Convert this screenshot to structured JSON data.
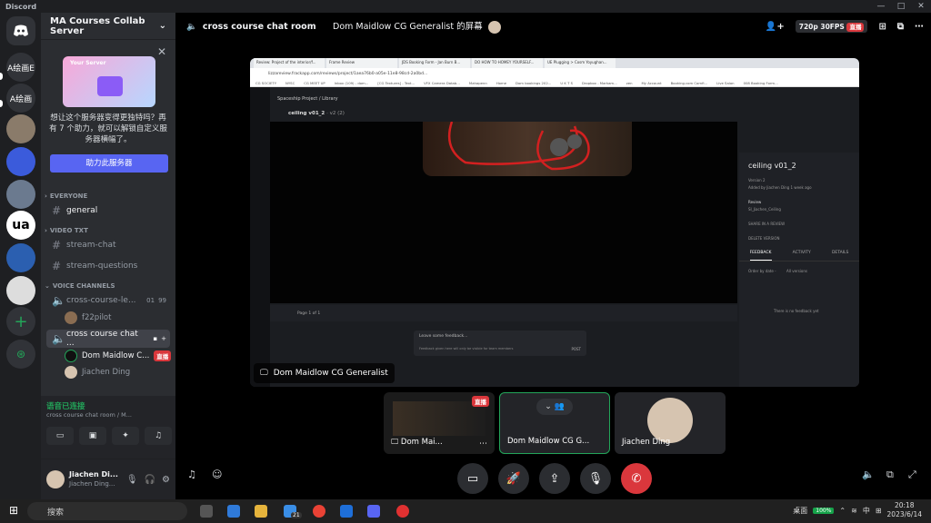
{
  "titlebar": {
    "app_name": "Discord",
    "minimize": "—",
    "maximize": "□",
    "close": "✕"
  },
  "servers": [
    {
      "label": "A绘画E"
    },
    {
      "label": "A绘画"
    },
    {
      "label": ""
    },
    {
      "label": ""
    },
    {
      "label": ""
    },
    {
      "label": "ua"
    },
    {
      "label": ""
    },
    {
      "label": ""
    }
  ],
  "guild": {
    "name": "MA Courses Collab Server"
  },
  "promo": {
    "badge": "Your Server",
    "text": "想让这个服务器变得更独特吗？再有 7 个助力，就可以解锁自定义服务器横幅了。",
    "button": "助力此服务器"
  },
  "categories": {
    "everyone": "EVERYONE",
    "video": "VIDEO TXT",
    "voice": "VOICE CHANNELS"
  },
  "channels": {
    "general": "general",
    "stream_chat": "stream-chat",
    "stream_questions": "stream-questions",
    "voice1": "cross-course-le...",
    "voice1_count": "01",
    "voice1_limit": "99",
    "voice1_user": "f22pilot",
    "voice2": "cross course chat ...",
    "voice2_user1": "Dom Maidlow C...",
    "voice2_live": "直播",
    "voice2_user2": "Jiachen Ding"
  },
  "voice_panel": {
    "status": "语音已连接",
    "sub": "cross course chat room / M..."
  },
  "userbar": {
    "name": "Jiachen Di...",
    "tag": "Jiachen Ding..."
  },
  "stage": {
    "channel": "cross course chat room",
    "stream_title": "Dom Maidlow CG Generalist 的屏幕",
    "quality": "720p 30FPS",
    "live": "直播"
  },
  "browser": {
    "tabs": [
      "Review: Project of the interior/f...",
      "Frame Review",
      "JDS Booking Form - Jan Burn B...",
      "DO HOW TO HOMEY YOURSELF...",
      "UE Plugging > Cosm Yoyughan..."
    ],
    "url": "lizzareview.frackapp.com/reviews/project/1aea76b0-a05e-11e8-98cd-2a0bd...",
    "bookmarks": [
      "CG SOCIETY",
      "NYSC",
      "CG MEET UP",
      "Inbox (109) - dom...",
      "[CG Textures] - Text...",
      "VFX Camera Datab...",
      "Mahapenn",
      "Home",
      "Dom bookings 202...",
      "U K T S",
      "Dropbox - Markam...",
      "zen",
      "My Account",
      "Booking.com Comfi...",
      "Live Salon",
      "008 Booking Form..."
    ]
  },
  "frame": {
    "breadcrumb": "Spaceship Project / Library",
    "version": "ceiling v01_2",
    "version_suffix": "· v2 (2)",
    "page": "Page 1 of 1",
    "feedback_placeholder": "Leave some feedback...",
    "feedback_note": "Feedback given here will only be visible for team members",
    "post": "POST",
    "panel_title": "ceiling v01_2",
    "panel_version": "Version 2",
    "panel_added": "Added by Jiachen Ding 1 week ago",
    "panel_review": "Review",
    "panel_review_name": "SI_Jiachen_Ceiling",
    "panel_share": "SHARE IN A REVIEW",
    "panel_delete": "DELETE VERSION",
    "tab_feedback": "FEEDBACK",
    "tab_activity": "ACTIVITY",
    "tab_details": "DETAILS",
    "order_by": "Order by date -",
    "all_versions": "All versions",
    "empty": "There is no feedback yet"
  },
  "screen_label": "Dom Maidlow CG Generalist",
  "tiles": {
    "t1_label": "Dom Mai...",
    "t1_live": "直播",
    "t2_label": "Dom Maidlow CG G...",
    "t3_label": "Jiachen Ding"
  },
  "taskbar": {
    "search": "搜索",
    "badge": "21",
    "desktop": "桌面",
    "battery": "100%",
    "ime": "中",
    "time": "20:18",
    "date": "2023/6/14"
  },
  "colors": {
    "accent": "#5865f2",
    "green": "#23a559",
    "red": "#da373c"
  }
}
